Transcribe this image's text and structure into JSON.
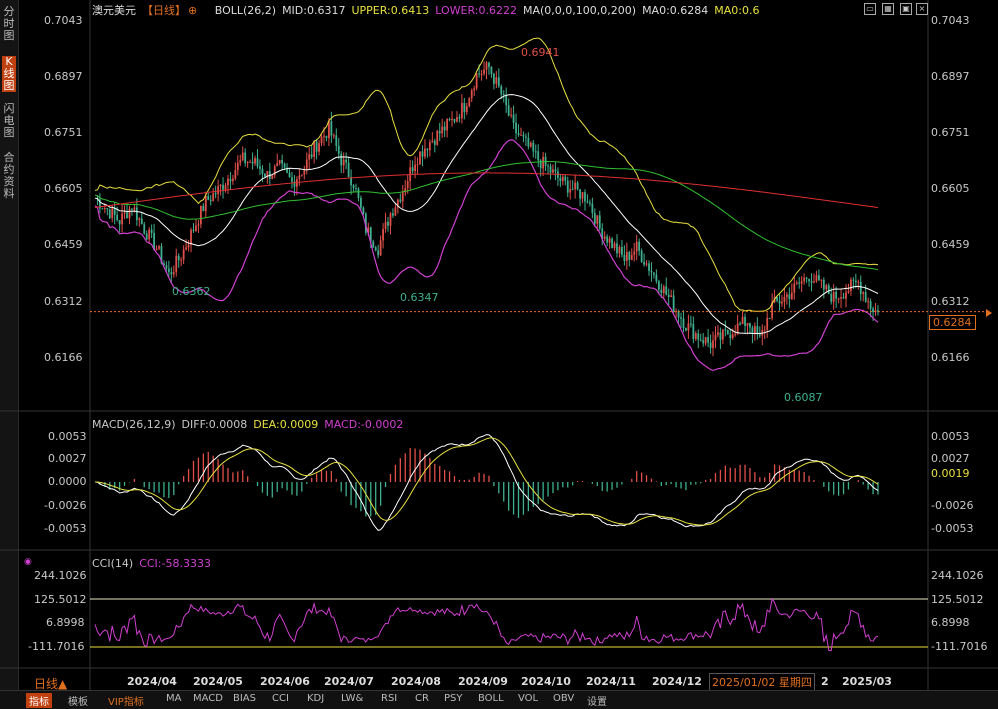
{
  "sidebar": {
    "tabs": [
      "分时图",
      "K线图",
      "闪电图",
      "合约资料"
    ],
    "active": 1
  },
  "header": {
    "instrument": "澳元美元",
    "period": "【日线】",
    "boll": "BOLL(26,2)",
    "boll_mid": "MID:0.6317",
    "boll_upper": "UPPER:0.6413",
    "boll_lower": "LOWER:0.6222",
    "ma": "MA(0,0,0,100,0,200)",
    "ma0": "MA0:0.6284",
    "ma0b": "MA0:0.6"
  },
  "macd_header": {
    "label": "MACD(26,12,9)",
    "diff": "DIFF:0.0008",
    "dea": "DEA:0.0009",
    "macd": "MACD:-0.0002"
  },
  "cci_header": {
    "label": "CCI(14)",
    "cci": "CCI:-58.3333"
  },
  "price_axis": {
    "ticks": [
      "0.7043",
      "0.6897",
      "0.6751",
      "0.6605",
      "0.6459",
      "0.6312",
      "0.6166"
    ],
    "current": "0.6284"
  },
  "macd_axis": {
    "ticks": [
      "0.0053",
      "0.0027",
      "0.0000",
      "-0.0026",
      "-0.0053"
    ],
    "current": "0.0019"
  },
  "cci_axis": {
    "ticks": [
      "244.1026",
      "125.5012",
      "6.8998",
      "-111.7016"
    ]
  },
  "annotations": {
    "high": "0.6941",
    "low1": "0.6362",
    "low2": "0.6347",
    "low3": "0.6087"
  },
  "x_axis": {
    "period_label": "日线▲",
    "labels": [
      "2024/04",
      "2024/05",
      "2024/06",
      "2024/07",
      "2024/08",
      "2024/09",
      "2024/10",
      "2024/11",
      "2024/12",
      "2025/01/02 星期四",
      "2",
      "2025/03"
    ]
  },
  "bottom_tabs": [
    "指标",
    "模板",
    "VIP指标",
    "MA",
    "MACD",
    "BIAS",
    "CCI",
    "KDJ",
    "LW&",
    "RSI",
    "CR",
    "PSY",
    "BOLL",
    "VOL",
    "OBV",
    "设置"
  ],
  "colors": {
    "up": "#e0504a",
    "down": "#3fb08f",
    "upper": "#e8e040",
    "lower": "#d040d0",
    "mid": "#ffffff",
    "ma100": "#30c030",
    "ma200": "#e03030",
    "cci": "#d040d0"
  },
  "chart_data": {
    "type": "candlestick",
    "title": "澳元美元 日线",
    "ylim": [
      0.6,
      0.71
    ],
    "x_range": [
      "2024/03",
      "2025/03"
    ],
    "key_levels": {
      "high": 0.6941,
      "low_apr": 0.6362,
      "low_aug": 0.6347,
      "low_jan": 0.6087,
      "last": 0.6284
    },
    "price_path": [
      [
        0,
        0.658
      ],
      [
        5,
        0.655
      ],
      [
        10,
        0.652
      ],
      [
        15,
        0.656
      ],
      [
        20,
        0.65
      ],
      [
        25,
        0.645
      ],
      [
        30,
        0.638
      ],
      [
        35,
        0.643
      ],
      [
        40,
        0.65
      ],
      [
        45,
        0.657
      ],
      [
        50,
        0.66
      ],
      [
        55,
        0.664
      ],
      [
        60,
        0.668
      ],
      [
        65,
        0.667
      ],
      [
        70,
        0.664
      ],
      [
        75,
        0.666
      ],
      [
        80,
        0.662
      ],
      [
        85,
        0.666
      ],
      [
        90,
        0.672
      ],
      [
        95,
        0.676
      ],
      [
        100,
        0.668
      ],
      [
        105,
        0.662
      ],
      [
        110,
        0.65
      ],
      [
        115,
        0.645
      ],
      [
        120,
        0.654
      ],
      [
        125,
        0.66
      ],
      [
        130,
        0.668
      ],
      [
        135,
        0.672
      ],
      [
        140,
        0.675
      ],
      [
        145,
        0.678
      ],
      [
        150,
        0.682
      ],
      [
        155,
        0.69
      ],
      [
        160,
        0.692
      ],
      [
        165,
        0.685
      ],
      [
        170,
        0.676
      ],
      [
        175,
        0.672
      ],
      [
        180,
        0.668
      ],
      [
        185,
        0.665
      ],
      [
        190,
        0.662
      ],
      [
        195,
        0.66
      ],
      [
        200,
        0.658
      ],
      [
        205,
        0.65
      ],
      [
        210,
        0.646
      ],
      [
        215,
        0.642
      ],
      [
        220,
        0.645
      ],
      [
        225,
        0.64
      ],
      [
        230,
        0.635
      ],
      [
        235,
        0.63
      ],
      [
        240,
        0.625
      ],
      [
        245,
        0.622
      ],
      [
        250,
        0.62
      ],
      [
        255,
        0.622
      ],
      [
        260,
        0.624
      ],
      [
        265,
        0.626
      ],
      [
        270,
        0.621
      ],
      [
        275,
        0.63
      ],
      [
        280,
        0.632
      ],
      [
        285,
        0.635
      ],
      [
        290,
        0.638
      ],
      [
        295,
        0.635
      ],
      [
        300,
        0.632
      ],
      [
        305,
        0.634
      ],
      [
        310,
        0.636
      ],
      [
        315,
        0.63
      ],
      [
        318,
        0.628
      ]
    ],
    "boll_upper_last": 0.6413,
    "boll_mid_last": 0.6317,
    "boll_lower_last": 0.6222,
    "macd": {
      "diff": 0.0008,
      "dea": 0.0009,
      "macd": -0.0002,
      "range": [
        -0.0053,
        0.0053
      ]
    },
    "cci": {
      "last": -58.3333,
      "levels": [
        125.5012,
        -111.7016
      ],
      "range": [
        -111.7016,
        244.1026
      ]
    }
  }
}
